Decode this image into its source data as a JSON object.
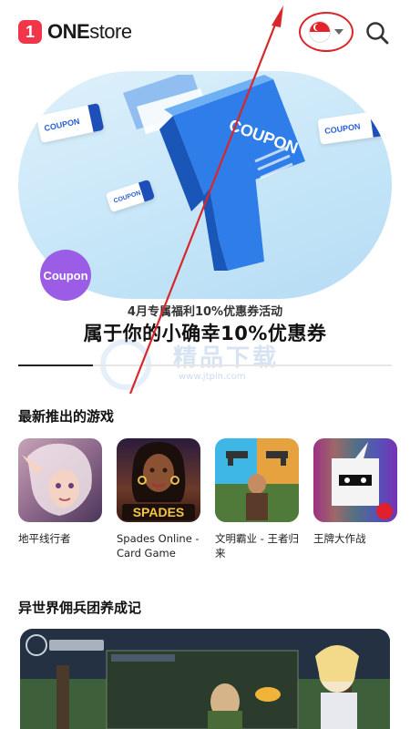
{
  "header": {
    "logo_badge": "1",
    "logo_bold": "ONE",
    "logo_rest": "store",
    "country_flag": "singapore-flag-icon",
    "search_icon": "search-icon"
  },
  "hero": {
    "coupon_tags": [
      "COUPON",
      "COUPON",
      "COUPON"
    ],
    "gun_label": "COUPON",
    "badge_label": "Coupon"
  },
  "promo": {
    "subtitle": "4月专属福利10%优惠券活动",
    "title": "属于你的小确幸10%优惠券"
  },
  "watermark": {
    "text": "精品下载",
    "url": "www.jtpin.com"
  },
  "carousel_progress": 0.2,
  "new_games": {
    "title": "最新推出的游戏",
    "items": [
      {
        "name": "地平线行者"
      },
      {
        "name": "Spades Online - Card Game",
        "icon_text": "SPADES"
      },
      {
        "name": "文明霸业 - 王者归来"
      },
      {
        "name": "王牌大作战"
      }
    ]
  },
  "featured": {
    "title": "异世界佣兵团养成记"
  },
  "colors": {
    "brand_red": "#f2364a",
    "annotation_red": "#d9262b",
    "coupon_purple": "#9b5de5",
    "coupon_blue": "#2e7de8"
  }
}
